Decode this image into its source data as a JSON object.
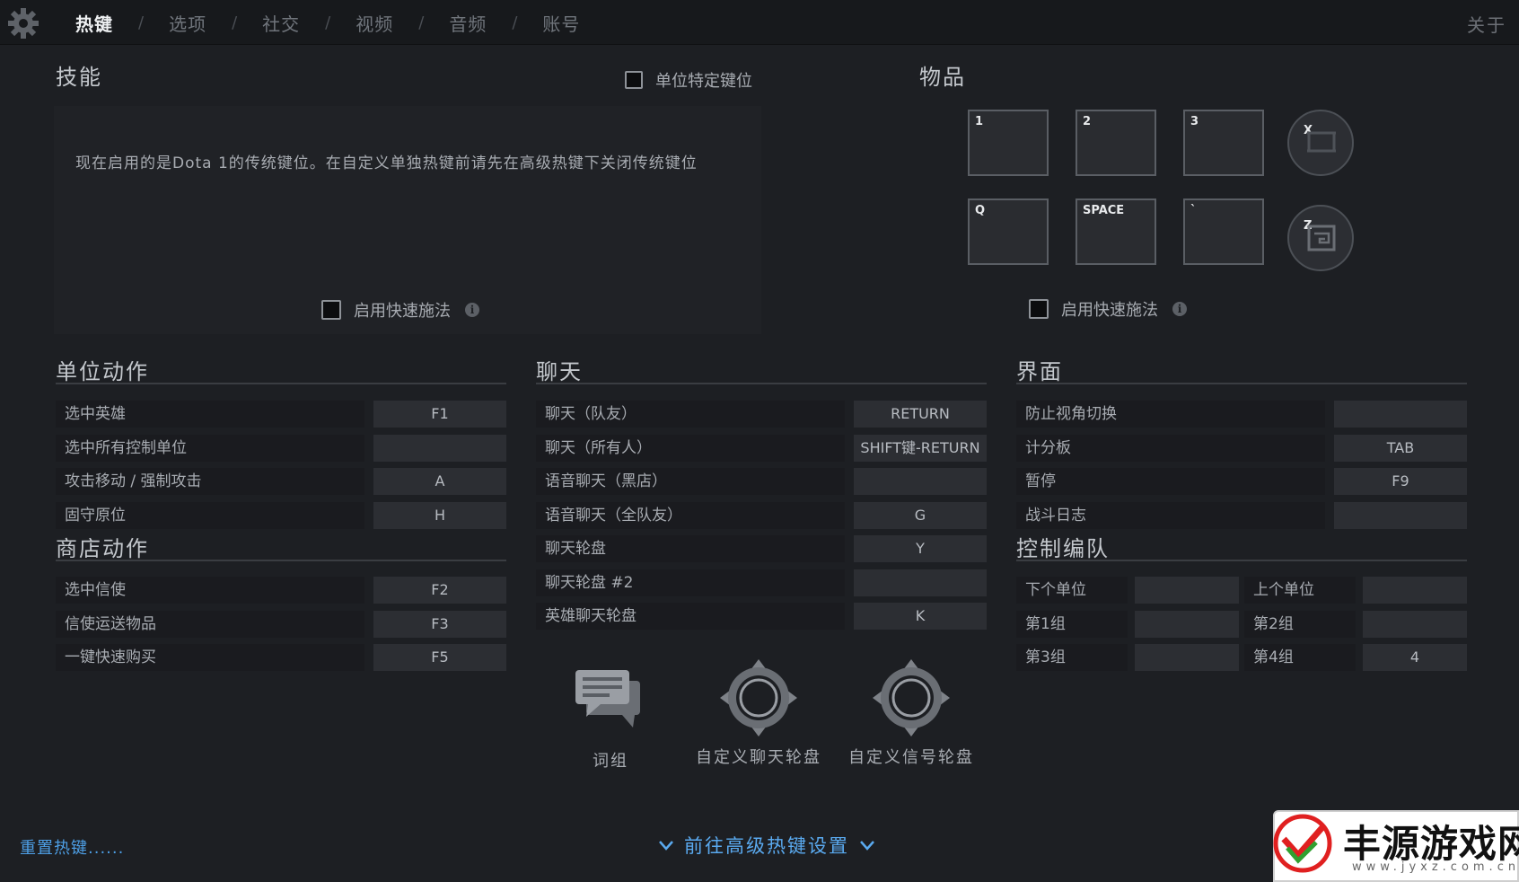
{
  "tabs": [
    "热键",
    "选项",
    "社交",
    "视频",
    "音频",
    "账号"
  ],
  "tab_separator": "/",
  "about": "关于",
  "abilities": {
    "title": "技能",
    "unit_specific_label": "单位特定键位",
    "message": "现在启用的是Dota 1的传统键位。在自定义单独热键前请先在高级热键下关闭传统键位",
    "quickcast_label": "启用快速施法",
    "info_glyph": "i"
  },
  "items": {
    "title": "物品",
    "slots": [
      "1",
      "2",
      "3",
      "Q",
      "SPACE",
      "`"
    ],
    "round_slots": [
      "X",
      "Z"
    ],
    "quickcast_label": "启用快速施法",
    "info_glyph": "i"
  },
  "unit_actions": {
    "title": "单位动作",
    "rows": [
      {
        "label": "选中英雄",
        "key": "F1"
      },
      {
        "label": "选中所有控制单位",
        "key": ""
      },
      {
        "label": "攻击移动 / 强制攻击",
        "key": "A"
      },
      {
        "label": "固守原位",
        "key": "H"
      }
    ]
  },
  "shop_actions": {
    "title": "商店动作",
    "rows": [
      {
        "label": "选中信使",
        "key": "F2"
      },
      {
        "label": "信使运送物品",
        "key": "F3"
      },
      {
        "label": "一键快速购买",
        "key": "F5"
      }
    ]
  },
  "chat": {
    "title": "聊天",
    "rows": [
      {
        "label": "聊天（队友）",
        "key": "RETURN"
      },
      {
        "label": "聊天（所有人）",
        "key": "SHIFT键-RETURN"
      },
      {
        "label": "语音聊天（黑店）",
        "key": ""
      },
      {
        "label": "语音聊天（全队友）",
        "key": "G"
      },
      {
        "label": "聊天轮盘",
        "key": "Y"
      },
      {
        "label": "聊天轮盘 #2",
        "key": ""
      },
      {
        "label": "英雄聊天轮盘",
        "key": "K"
      }
    ]
  },
  "interface": {
    "title": "界面",
    "rows": [
      {
        "label": "防止视角切换",
        "key": ""
      },
      {
        "label": "计分板",
        "key": "TAB"
      },
      {
        "label": "暂停",
        "key": "F9"
      },
      {
        "label": "战斗日志",
        "key": ""
      }
    ]
  },
  "control_groups": {
    "title": "控制编队",
    "cells": [
      {
        "label": "下个单位",
        "key": ""
      },
      {
        "label": "上个单位",
        "key": ""
      },
      {
        "label": "第1组",
        "key": ""
      },
      {
        "label": "第2组",
        "key": ""
      },
      {
        "label": "第3组",
        "key": ""
      },
      {
        "label": "第4组",
        "key": "4"
      }
    ]
  },
  "bottom_buttons": [
    {
      "label": "词组",
      "icon": "chat-bubbles-icon"
    },
    {
      "label": "自定义聊天轮盘",
      "icon": "chat-wheel-icon"
    },
    {
      "label": "自定义信号轮盘",
      "icon": "ping-wheel-icon"
    }
  ],
  "reset_link": "重置热键......",
  "advanced_link": "前往高级热键设置",
  "watermark": {
    "text": "丰源游戏网",
    "url": "www.jyxz.com.cn"
  },
  "colors": {
    "accent_link": "#4d9fe6",
    "background": "#1d1f23"
  }
}
